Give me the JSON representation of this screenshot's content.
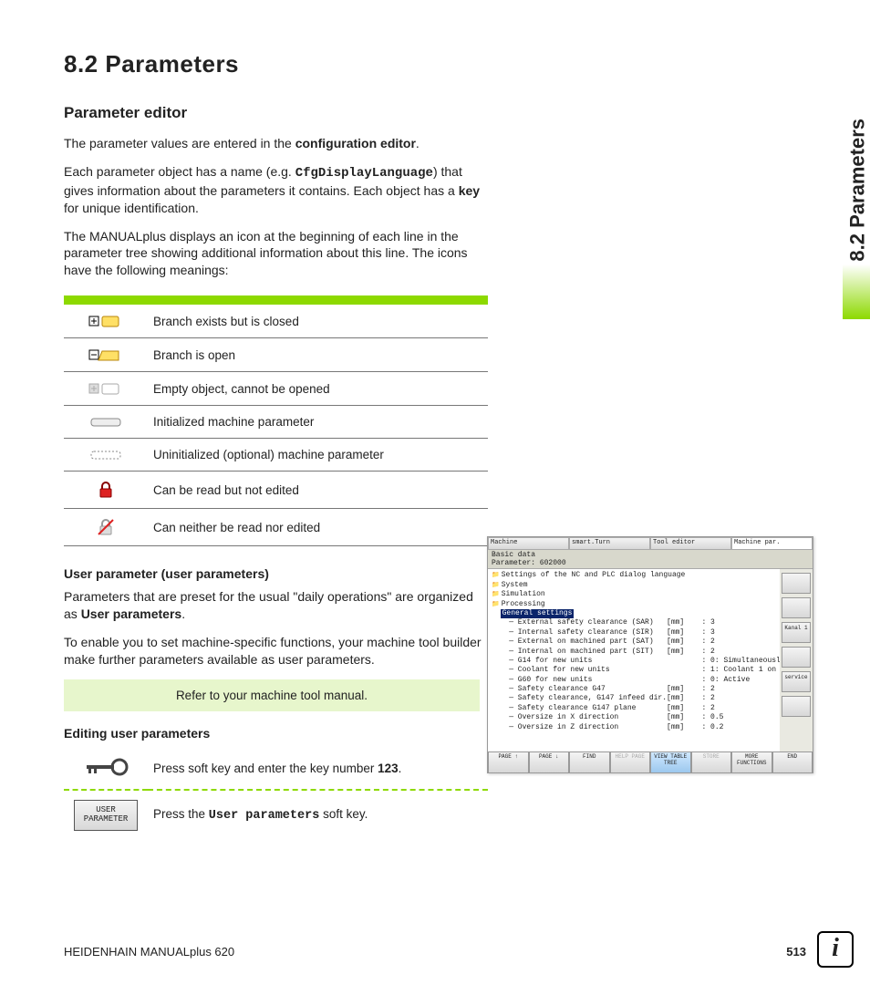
{
  "section": {
    "number_title": "8.2  Parameters",
    "side_label": "8.2 Parameters",
    "sub_title": "Parameter editor"
  },
  "paragraphs": {
    "p1_a": "The parameter values are entered in the ",
    "p1_b": "configuration editor",
    "p2_a": "Each parameter object has a name (e.g. ",
    "p2_code": "CfgDisplayLanguage",
    "p2_b": ") that gives information about the parameters it contains. Each object has a ",
    "p2_key": "key",
    "p2_c": " for unique identification.",
    "p3": "The MANUALplus displays an icon at the beginning of each line in the parameter tree showing additional information about this line. The icons have the following meanings:"
  },
  "icon_rows": [
    {
      "id": "branch-closed",
      "desc": "Branch exists but is closed"
    },
    {
      "id": "branch-open",
      "desc": "Branch is open"
    },
    {
      "id": "empty-object",
      "desc": "Empty object, cannot be opened"
    },
    {
      "id": "init-param",
      "desc": "Initialized machine parameter"
    },
    {
      "id": "uninit-param",
      "desc": "Uninitialized (optional) machine parameter"
    },
    {
      "id": "read-only",
      "desc": "Can be read but not edited"
    },
    {
      "id": "no-access",
      "desc": "Can neither be read nor edited"
    }
  ],
  "user_params": {
    "heading": "User parameter (user parameters)",
    "p1_a": "Parameters that are preset for the usual \"daily operations\" are organized as ",
    "p1_b": "User parameters",
    "p2": "To enable you to set machine-specific functions, your machine tool builder make further parameters available as user parameters.",
    "note": "Refer to your machine tool manual.",
    "edit_heading": "Editing user parameters",
    "step1_a": "Press soft key and enter the key number ",
    "step1_b": "123",
    "step2_a": "Press the ",
    "step2_code": "User parameters",
    "step2_b": " soft key.",
    "softkey_label_line1": "USER",
    "softkey_label_line2": "PARAMETER"
  },
  "screenshot": {
    "tabs": [
      "Machine",
      "smart.Turn",
      "Tool editor",
      "Machine par."
    ],
    "header_line1": "Basic data",
    "header_line2": "Parameter: 602000",
    "tree_top": [
      "Settings of the NC and PLC dialog language",
      "System",
      "Simulation",
      "Processing"
    ],
    "tree_selected": "General settings",
    "tree_rows": [
      {
        "label": "External safety clearance (SAR)",
        "unit": "[mm]",
        "val": ": 3"
      },
      {
        "label": "Internal safety clearance (SIR)",
        "unit": "[mm]",
        "val": ": 3"
      },
      {
        "label": "External on machined part (SAT)",
        "unit": "[mm]",
        "val": ": 2"
      },
      {
        "label": "Internal on machined part (SIT)",
        "unit": "[mm]",
        "val": ": 2"
      },
      {
        "label": "G14 for new units",
        "unit": "",
        "val": ": 0: Simultaneously"
      },
      {
        "label": "Coolant for new units",
        "unit": "",
        "val": ": 1: Coolant 1 on"
      },
      {
        "label": "G60 for new units",
        "unit": "",
        "val": ": 0: Active"
      },
      {
        "label": "Safety clearance G47",
        "unit": "[mm]",
        "val": ": 2"
      },
      {
        "label": "Safety clearance, G147 infeed dir.",
        "unit": "[mm]",
        "val": ": 2"
      },
      {
        "label": "Safety clearance G147 plane",
        "unit": "[mm]",
        "val": ": 2"
      },
      {
        "label": "Oversize in X direction",
        "unit": "[mm]",
        "val": ": 0.5"
      },
      {
        "label": "Oversize in Z direction",
        "unit": "[mm]",
        "val": ": 0.2"
      }
    ],
    "side_buttons": [
      "",
      "",
      "Kanal 1",
      "",
      "service",
      ""
    ],
    "softkeys": [
      "PAGE ↑",
      "PAGE ↓",
      "FIND",
      "HELP PAGE",
      "VIEW TABLE TREE",
      "STORE",
      "MORE FUNCTIONS",
      "END"
    ]
  },
  "footer": {
    "left": "HEIDENHAIN MANUALplus 620",
    "page": "513"
  }
}
